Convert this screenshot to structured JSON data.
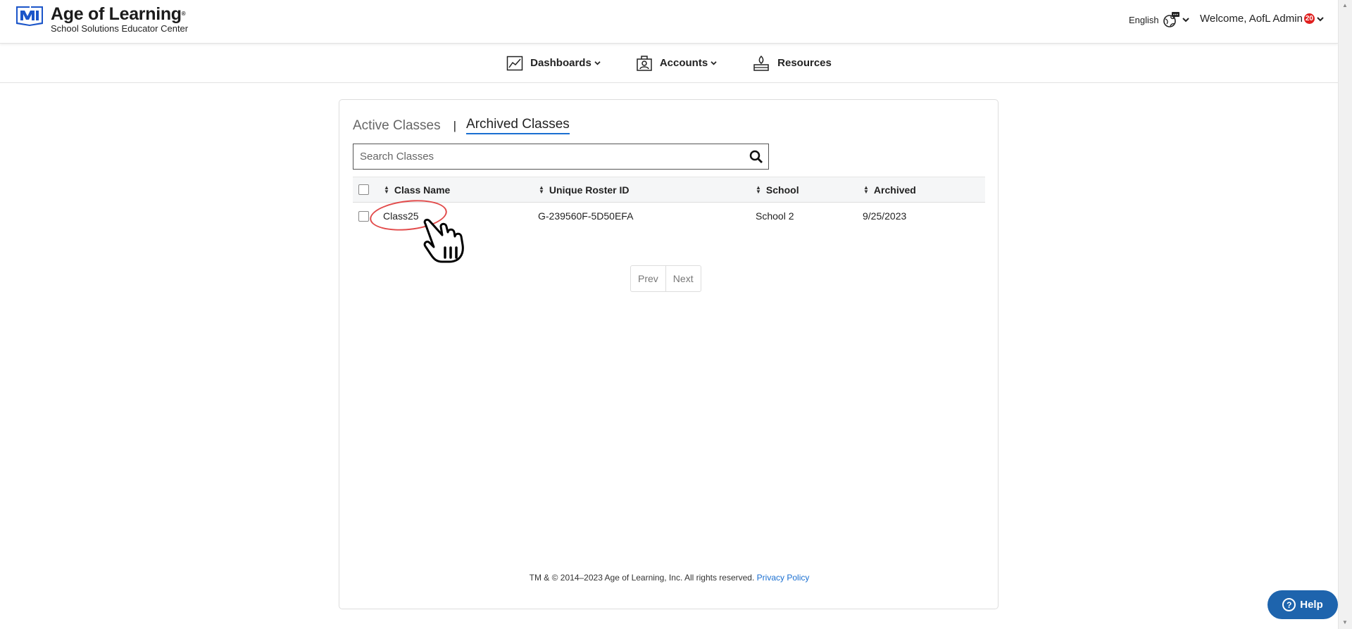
{
  "header": {
    "brand_title": "Age of Learning",
    "brand_sub": "School Solutions Educator Center",
    "language": "English",
    "welcome": "Welcome, AofL Admin",
    "notification_count": "20"
  },
  "nav": {
    "items": [
      {
        "label": "Dashboards",
        "icon": "chart-icon",
        "dropdown": true
      },
      {
        "label": "Accounts",
        "icon": "accounts-icon",
        "dropdown": true
      },
      {
        "label": "Resources",
        "icon": "resources-icon",
        "dropdown": false
      }
    ]
  },
  "tabs": {
    "active": "Active Classes",
    "separator": "|",
    "archived": "Archived Classes"
  },
  "search": {
    "placeholder": "Search Classes"
  },
  "table": {
    "columns": [
      "Class Name",
      "Unique Roster ID",
      "School",
      "Archived"
    ],
    "rows": [
      {
        "class_name": "Class25",
        "roster_id": "G-239560F-5D50EFA",
        "school": "School 2",
        "archived": "9/25/2023"
      }
    ]
  },
  "pager": {
    "prev": "Prev",
    "next": "Next"
  },
  "footer": {
    "copyright": "TM & © 2014–2023 Age of Learning, Inc. All rights reserved.",
    "privacy": "Privacy Policy"
  },
  "help": {
    "label": "Help"
  },
  "colors": {
    "brand_blue": "#1a6fd1",
    "help_blue": "#1e64ad",
    "badge_red": "#e0201f",
    "highlight_red": "#e24a4a"
  }
}
